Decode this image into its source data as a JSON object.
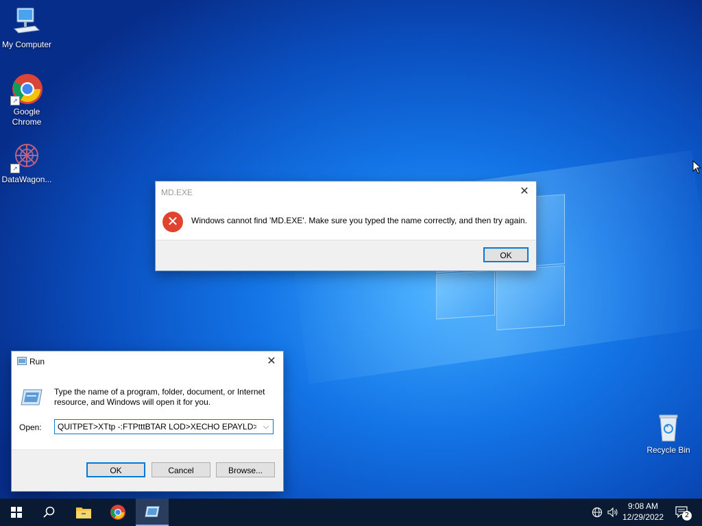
{
  "desktop": {
    "icons": [
      {
        "label": "My Computer"
      },
      {
        "label": "Google Chrome"
      },
      {
        "label": "DataWagon..."
      },
      {
        "label": "Recycle Bin"
      }
    ]
  },
  "error_dialog": {
    "title": "MD.EXE",
    "message": "Windows cannot find 'MD.EXE'. Make sure you typed the name correctly, and then try again.",
    "ok_label": "OK",
    "icon": "error-icon"
  },
  "run_dialog": {
    "title": "Run",
    "description": "Type the name of a program, folder, document, or Internet resource, and Windows will open it for you.",
    "open_label": "Open:",
    "open_value": "QUITPET>XTtp -:FTPtttBTAR LOD>XECHO EPAYLD>EE>",
    "ok_label": "OK",
    "cancel_label": "Cancel",
    "browse_label": "Browse..."
  },
  "taskbar": {
    "apps": [
      "start-icon",
      "search-icon",
      "file-explorer-icon",
      "chrome-icon",
      "run-icon"
    ],
    "time": "9:08 AM",
    "date": "12/29/2022",
    "notification_count": "2"
  },
  "colors": {
    "accent": "#0078d7",
    "taskbar": "#0b1a33",
    "error_red": "#e0432e"
  }
}
